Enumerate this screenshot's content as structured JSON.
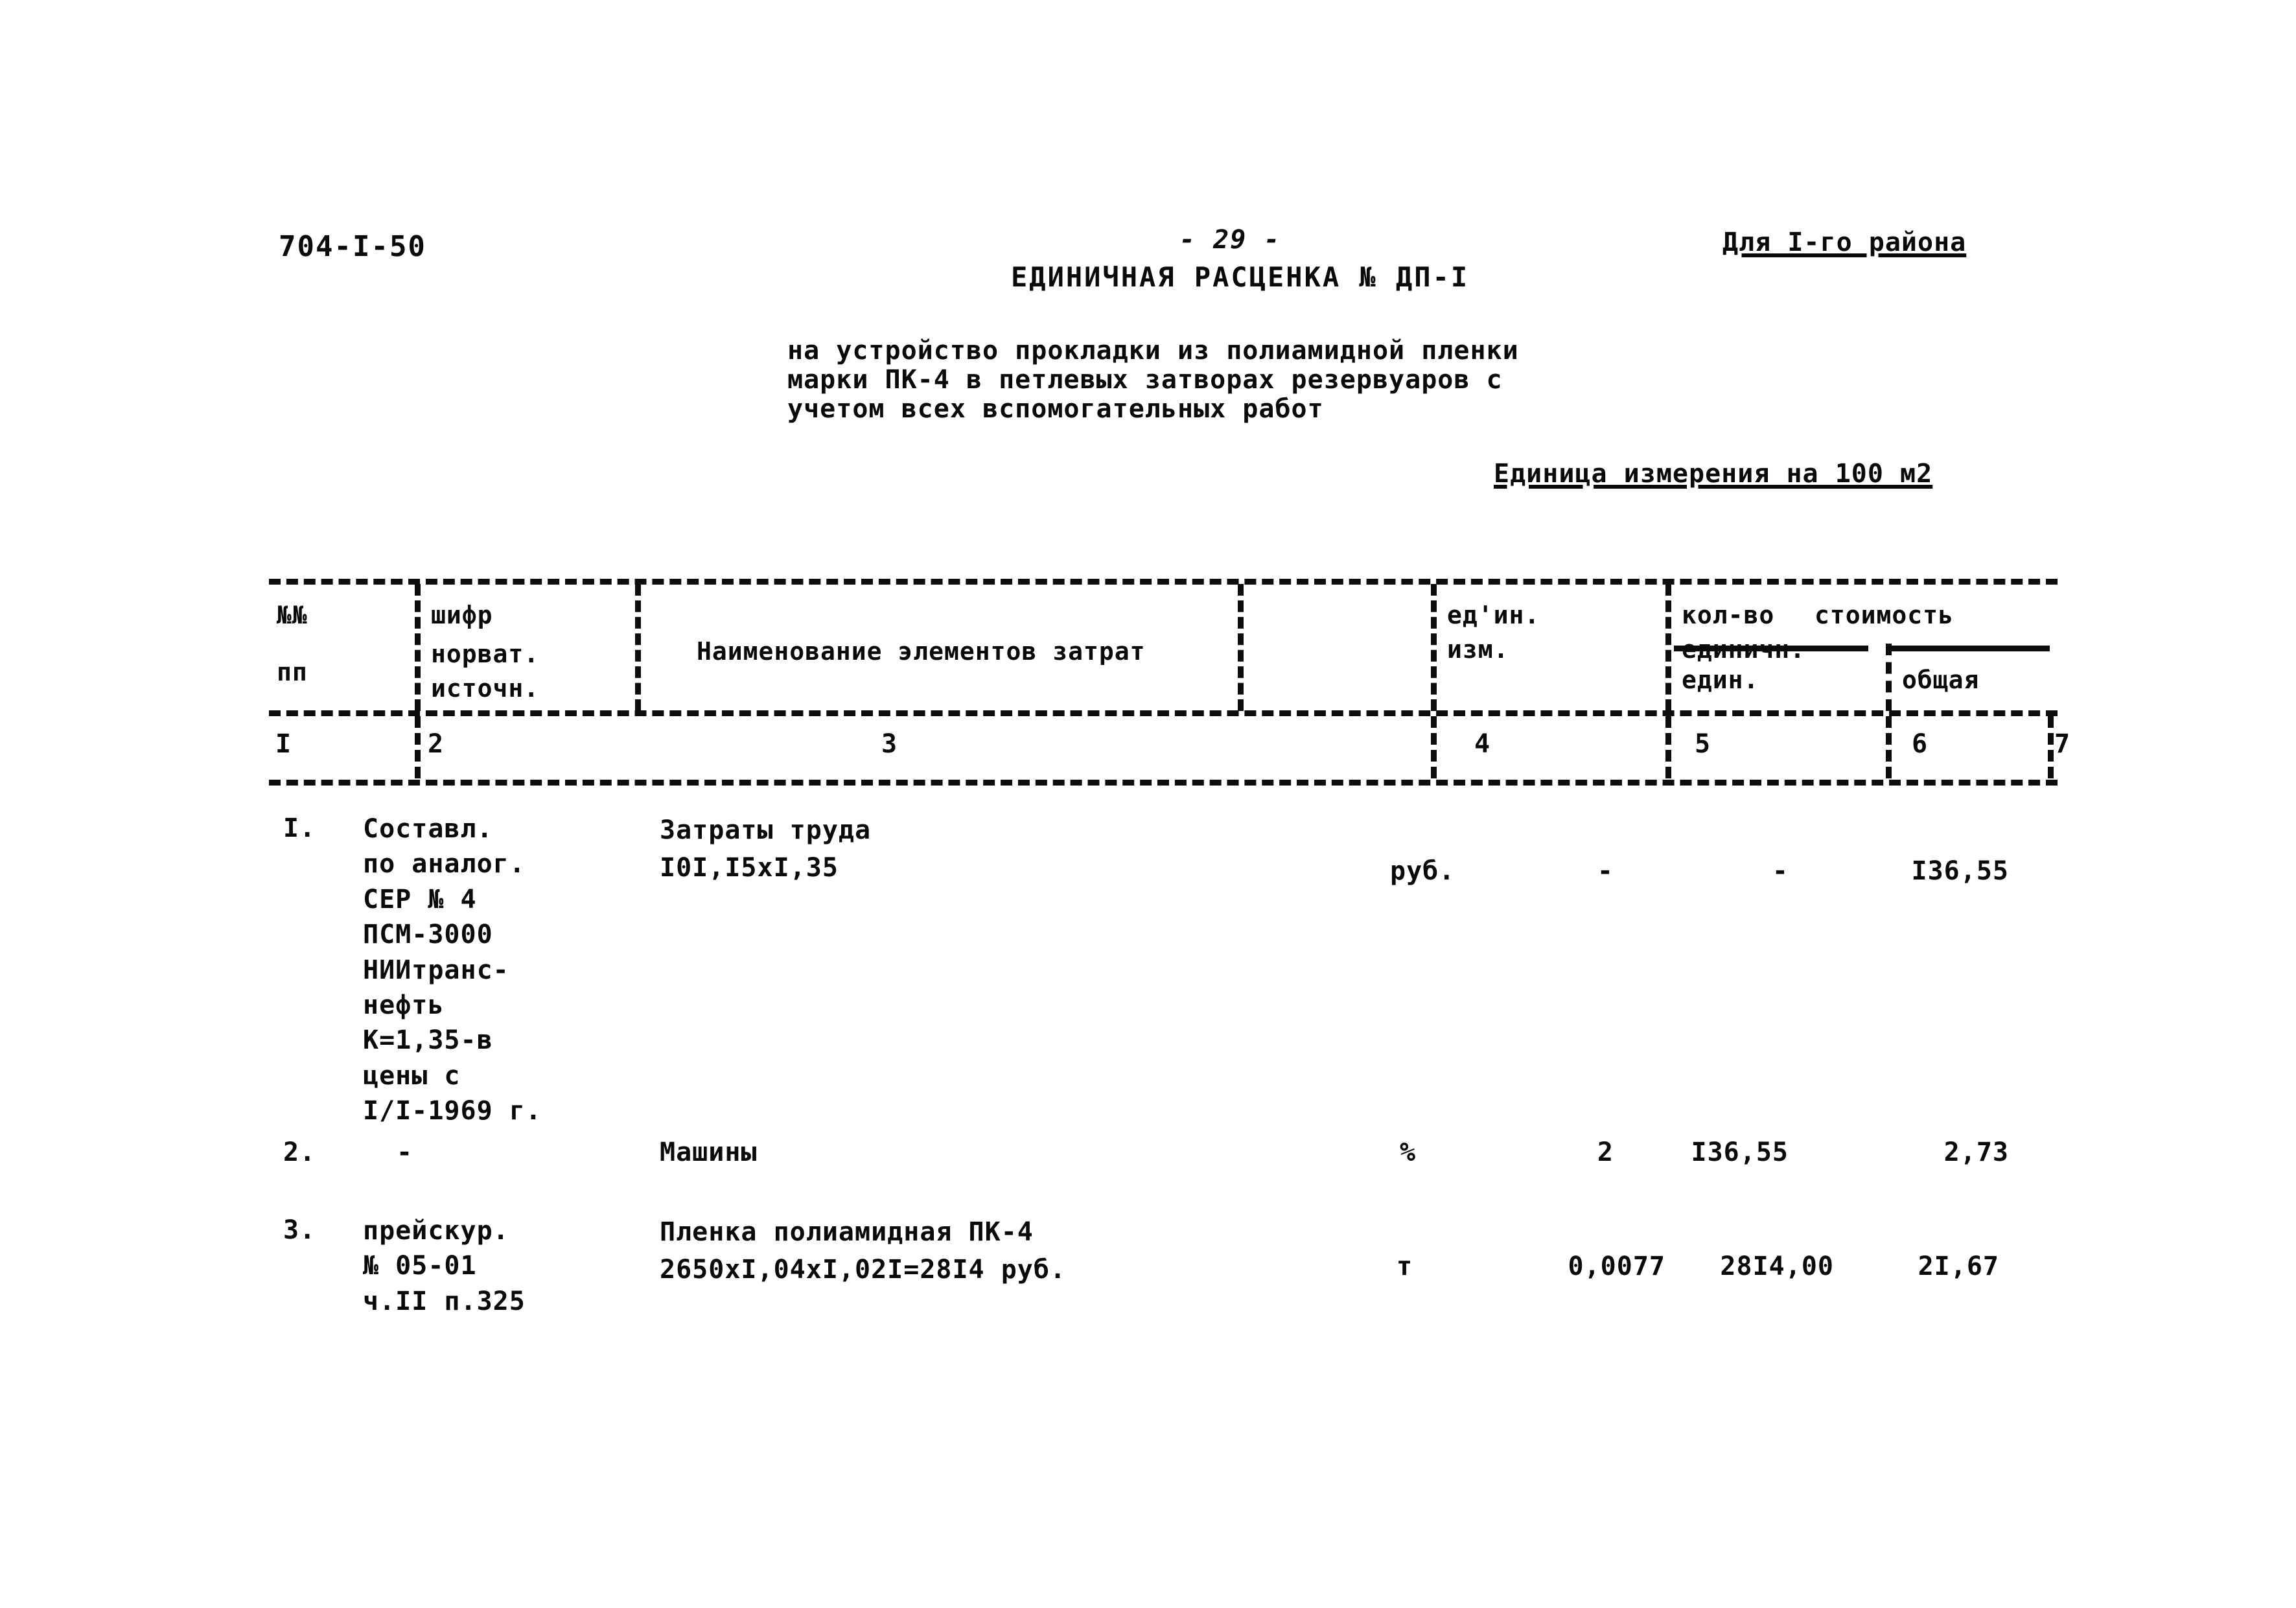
{
  "document": {
    "code": "704-I-50",
    "page_number": "- 29 -",
    "region_note": "Для I-го района",
    "estimate_title": "ЕДИНИЧНАЯ РАСЦЕНКА № ДП-I",
    "subtitle_line1": "на устройство прокладки из полиамидной пленки",
    "subtitle_line2": "марки ПК-4 в петлевых затворах резервуаров с",
    "subtitle_line3": "учетом всех вспомогательных работ",
    "unit_of_measure": "Единица измерения на 100 м2"
  },
  "table": {
    "headers": {
      "col1_line1": "№№",
      "col1_line2": "пп",
      "col2_line1": "шифр",
      "col2_line2": "норват.",
      "col2_line3": "источн.",
      "col3": "Наименование элементов затрат",
      "col4_line1": "ед'ин.",
      "col4_line2": "изм.",
      "col5_line1": "кол-во",
      "col5_line2": "единичн.",
      "col67_group": "стоимость",
      "col6": "един.",
      "col7": "общая"
    },
    "column_numbers": [
      "I",
      "2",
      "3",
      "4",
      "5",
      "6",
      "7"
    ],
    "rows": [
      {
        "no": "I.",
        "source_lines": [
          "Составл.",
          "по аналог.",
          "СЕР № 4",
          "ПСМ-3000",
          "НИИтранс-",
          "нефть",
          "К=1,35-в",
          "цены с",
          "I/I-1969 г."
        ],
        "name_lines": [
          "Затраты труда",
          "I0I,I5xI,35"
        ],
        "unit": "руб.",
        "quantity": "-",
        "price_unit": "-",
        "price_total": "I36,55"
      },
      {
        "no": "2.",
        "source_lines": [
          "-"
        ],
        "name_lines": [
          "Машины"
        ],
        "unit": "%",
        "quantity": "2",
        "price_unit": "I36,55",
        "price_total": "2,73"
      },
      {
        "no": "3.",
        "source_lines": [
          "прейскур.",
          "№ 05-01",
          "ч.II п.325"
        ],
        "name_lines": [
          "Пленка полиамидная ПК-4",
          "2650xI,04xI,02I=28I4 руб."
        ],
        "unit": "т",
        "quantity": "0,0077",
        "price_unit": "28I4,00",
        "price_total": "2I,67"
      }
    ]
  }
}
